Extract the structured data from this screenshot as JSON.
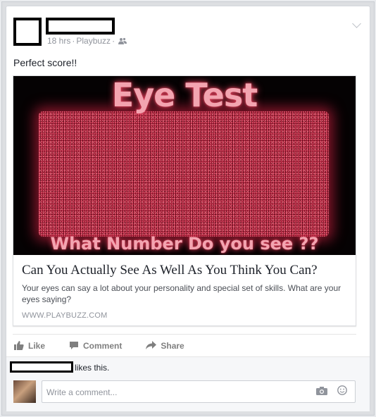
{
  "post": {
    "time": "18 hrs",
    "separator": "·",
    "app": "Playbuzz",
    "separator2": "·",
    "text": "Perfect score!!"
  },
  "link": {
    "image_title": "Eye Test",
    "image_subtitle": "What Number Do you see ??",
    "title": "Can You Actually See As Well As You Think You Can?",
    "description": "Your eyes can say a lot about your personality and special set of skills. What are your eyes saying?",
    "domain": "WWW.PLAYBUZZ.COM"
  },
  "actions": {
    "like": "Like",
    "comment": "Comment",
    "share": "Share"
  },
  "likes": {
    "text": "likes this."
  },
  "comment": {
    "placeholder": "Write a comment..."
  },
  "icons": [
    "people-icon",
    "chevron-down-icon",
    "like-icon",
    "comment-icon",
    "share-icon",
    "camera-icon",
    "smiley-icon"
  ],
  "colors": {
    "text": "#1d2129",
    "meta": "#90949c",
    "action": "#7f7f7f",
    "accent_pink": "#f3a4b0",
    "noise_red": "#b3243e"
  }
}
